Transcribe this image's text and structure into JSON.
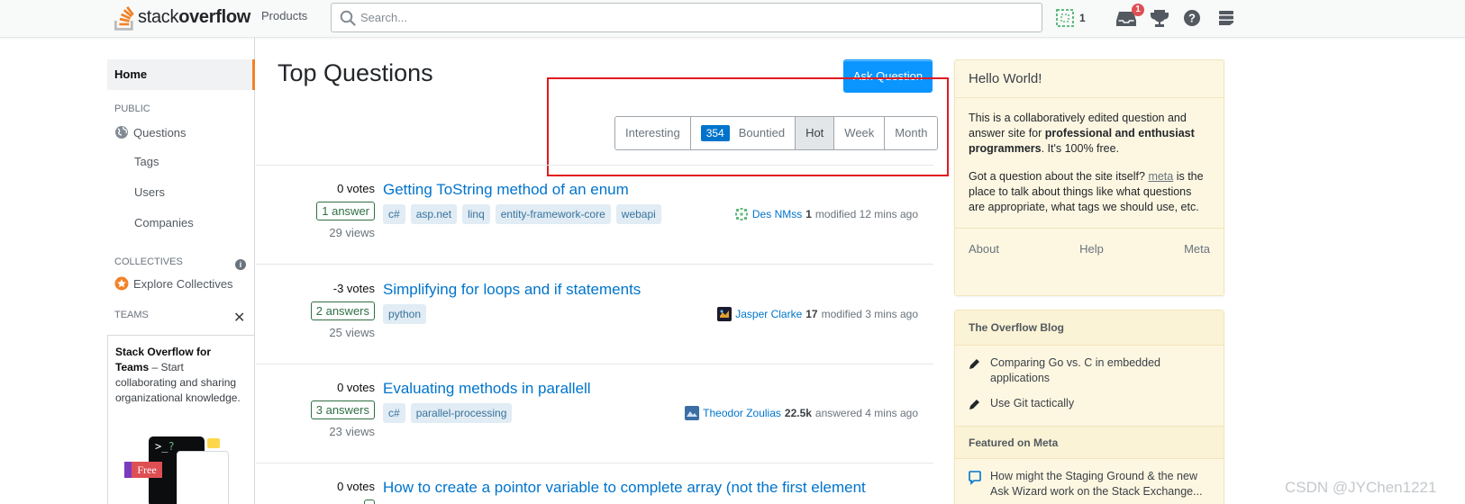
{
  "topbar": {
    "logo": {
      "text_plain": "stack",
      "text_bold": "overflow"
    },
    "products_label": "Products",
    "search": {
      "placeholder": "Search...",
      "value": ""
    },
    "reputation": "1",
    "inbox_count": "1",
    "icons": [
      "achievements-icon",
      "inbox-icon",
      "trophy-icon",
      "help-icon",
      "site-switcher-icon"
    ]
  },
  "leftnav": {
    "home": "Home",
    "public_label": "PUBLIC",
    "items": [
      {
        "label": "Questions",
        "icon": "globe-icon"
      },
      {
        "label": "Tags"
      },
      {
        "label": "Users"
      },
      {
        "label": "Companies"
      }
    ],
    "collectives_label": "COLLECTIVES",
    "explore_collectives": "Explore Collectives",
    "teams_label": "TEAMS",
    "teams_box": {
      "title": "Stack Overflow for Teams",
      "text": " – Start collaborating and sharing organizational knowledge.",
      "free_label": "Free",
      "terminal_prompt": ">_",
      "terminal_q": "?"
    }
  },
  "main": {
    "title": "Top Questions",
    "ask_button": "Ask Question",
    "filters": [
      {
        "label": "Interesting",
        "active": false
      },
      {
        "label": "Bountied",
        "badge": "354",
        "active": false
      },
      {
        "label": "Hot",
        "active": true
      },
      {
        "label": "Week",
        "active": false
      },
      {
        "label": "Month",
        "active": false
      }
    ],
    "questions": [
      {
        "votes": "0 votes",
        "answers": "1 answer",
        "views": "29 views",
        "title": "Getting ToString method of an enum",
        "tags": [
          "c#",
          "asp.net",
          "linq",
          "entity-framework-core",
          "webapi"
        ],
        "user": "Des NMss",
        "rep": "1",
        "action": "modified 12 mins ago",
        "avatar_color": "#5eba7d"
      },
      {
        "votes": "-3 votes",
        "answers": "2 answers",
        "views": "25 views",
        "title": "Simplifying for loops and if statements",
        "tags": [
          "python"
        ],
        "user": "Jasper Clarke",
        "rep": "17",
        "action": "modified 3 mins ago",
        "avatar_color": "#1b1b2f"
      },
      {
        "votes": "0 votes",
        "answers": "3 answers",
        "views": "23 views",
        "title": "Evaluating methods in parallell",
        "tags": [
          "c#",
          "parallel-processing"
        ],
        "user": "Theodor Zoulias",
        "rep": "22.5k",
        "action": "answered 4 mins ago",
        "avatar_color": "#3a6ea5"
      },
      {
        "votes": "0 votes",
        "title": "How to create a pointor variable to complete array (not the first element"
      }
    ]
  },
  "sidebar": {
    "hello": {
      "title": "Hello World!",
      "p1_a": "This is a collaboratively edited question and answer site for ",
      "p1_b": "professional and enthusiast programmers",
      "p1_c": ". It's 100% free.",
      "p2_a": "Got a question about the site itself? ",
      "p2_link": "meta",
      "p2_b": " is the place to talk about things like what questions are appropriate, what tags we should use, etc.",
      "footer": [
        "About",
        "Help",
        "Meta"
      ]
    },
    "blog": {
      "title": "The Overflow Blog",
      "items": [
        "Comparing Go vs. C in embedded applications",
        "Use Git tactically"
      ],
      "featured_title": "Featured on Meta",
      "featured_items": [
        "How might the Staging Ground & the new Ask Wizard work on the Stack Exchange..."
      ]
    }
  },
  "watermark": "CSDN @JYChen1221",
  "colors": {
    "accent": "#f48225",
    "link": "#0074cc",
    "primary_button": "#0a95ff",
    "answered": "#2f6f44",
    "tag_bg": "#e1ecf4",
    "widget_bg": "#fdf7e2",
    "highlight_box": "#e01a1f"
  }
}
